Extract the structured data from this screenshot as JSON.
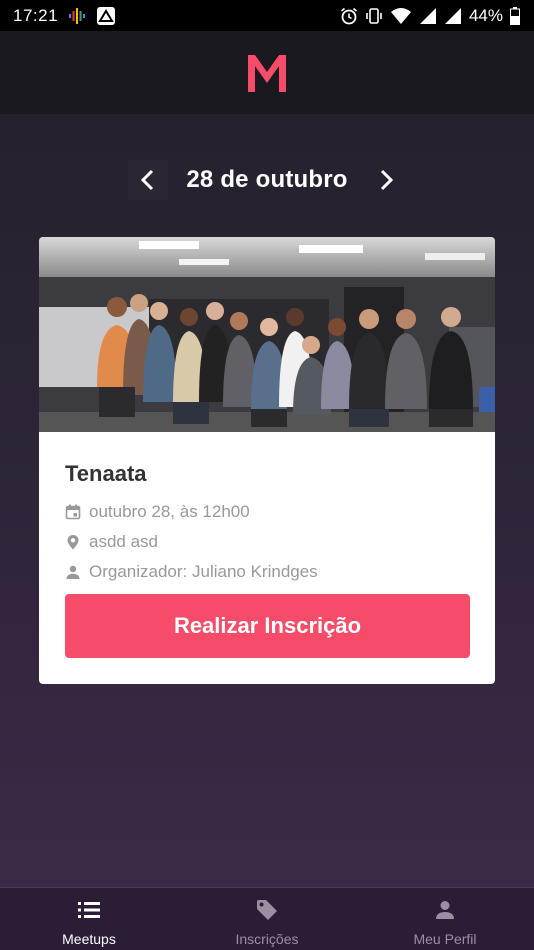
{
  "status_bar": {
    "time": "17:21",
    "battery": "44%"
  },
  "colors": {
    "accent": "#f64c69",
    "header_bg": "#1b1920",
    "tab_bg": "#2a1d35"
  },
  "header": {
    "logo_icon": "meetapp-m-logo"
  },
  "date_nav": {
    "prev_icon": "chevron-left-icon",
    "date_label": "28 de outubro",
    "next_icon": "chevron-right-icon"
  },
  "meetup": {
    "title": "Tenaata",
    "date_text": "outubro 28, às 12h00",
    "location": "asdd asd",
    "organizer": "Organizador: Juliano Krindges",
    "action_label": "Realizar Inscrição"
  },
  "tabs": [
    {
      "label": "Meetups",
      "icon": "list-icon",
      "active": true
    },
    {
      "label": "Inscrições",
      "icon": "tag-icon",
      "active": false
    },
    {
      "label": "Meu Perfil",
      "icon": "person-icon",
      "active": false
    }
  ]
}
